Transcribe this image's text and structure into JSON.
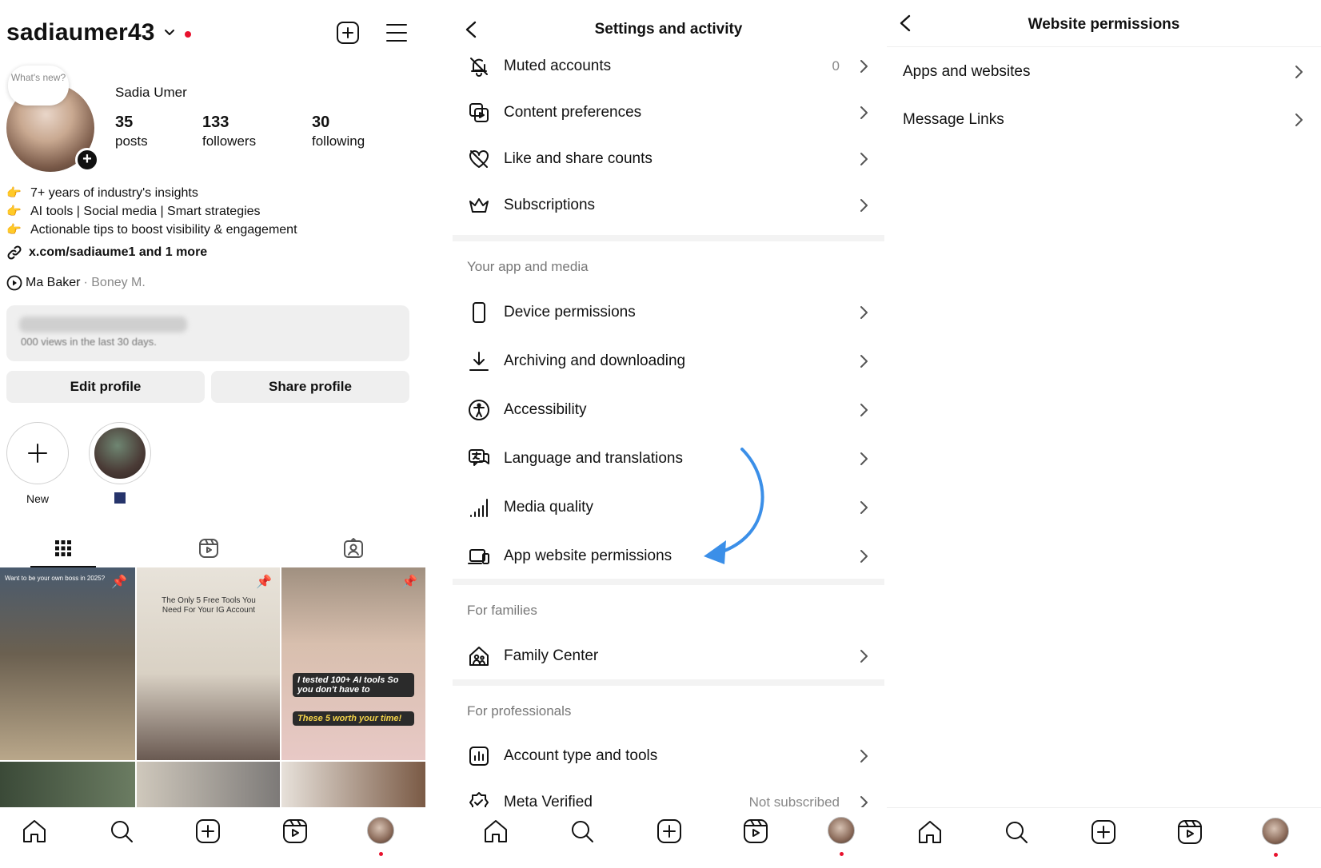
{
  "profile": {
    "username": "sadiaumer43",
    "note_bubble": "What's new?",
    "display_name": "Sadia Umer",
    "stats": [
      {
        "value": "35",
        "label": "posts"
      },
      {
        "value": "133",
        "label": "followers"
      },
      {
        "value": "30",
        "label": "following"
      }
    ],
    "bio": [
      "7+ years of industry's insights",
      "AI tools | Social media | Smart strategies",
      "Actionable tips to boost visibility & engagement"
    ],
    "link": "x.com/sadiaume1 and 1 more",
    "music": {
      "song": "Ma Baker",
      "artist": "· Boney M."
    },
    "dashboard_subtitle": "000 views in the last 30 days.",
    "edit_button": "Edit profile",
    "share_button": "Share profile",
    "highlights": [
      {
        "label": "New"
      }
    ],
    "posts": [
      {
        "caption": "Want to be your own boss in 2025?"
      },
      {
        "caption": "The Only 5 Free Tools You Need For Your IG Account"
      },
      {
        "caption_1": "I tested 100+ AI tools So you don't have to",
        "caption_2": "These 5 worth your time!"
      }
    ]
  },
  "settings": {
    "title": "Settings and activity",
    "rows_top": [
      {
        "label": "Muted accounts",
        "value": "0",
        "icon": "muted-bell-icon"
      },
      {
        "label": "Content preferences",
        "icon": "content-preferences-icon"
      },
      {
        "label": "Like and share counts",
        "icon": "heart-off-icon"
      },
      {
        "label": "Subscriptions",
        "icon": "crown-icon"
      }
    ],
    "section_app_media": "Your app and media",
    "rows_app_media": [
      {
        "label": "Device permissions",
        "icon": "phone-icon"
      },
      {
        "label": "Archiving and downloading",
        "icon": "download-icon"
      },
      {
        "label": "Accessibility",
        "icon": "accessibility-icon"
      },
      {
        "label": "Language and translations",
        "icon": "translate-icon"
      },
      {
        "label": "Media quality",
        "icon": "signal-bars-icon"
      },
      {
        "label": "App website permissions",
        "icon": "devices-icon"
      }
    ],
    "section_families": "For families",
    "rows_families": [
      {
        "label": "Family Center",
        "icon": "family-home-icon"
      }
    ],
    "section_professionals": "For professionals",
    "rows_professionals": [
      {
        "label": "Account type and tools",
        "icon": "bar-chart-icon"
      },
      {
        "label": "Meta Verified",
        "value": "Not subscribed",
        "icon": "verified-badge-icon"
      }
    ],
    "annotation_arrow_color": "#3b8fe8"
  },
  "website_permissions": {
    "title": "Website permissions",
    "rows": [
      {
        "label": "Apps and websites"
      },
      {
        "label": "Message Links"
      }
    ]
  },
  "tabbar": [
    "home-icon",
    "search-icon",
    "create-icon",
    "reels-icon",
    "profile-avatar"
  ],
  "colors": {
    "notification_dot": "#e8112d",
    "accent_blue": "#3b8fe8"
  }
}
